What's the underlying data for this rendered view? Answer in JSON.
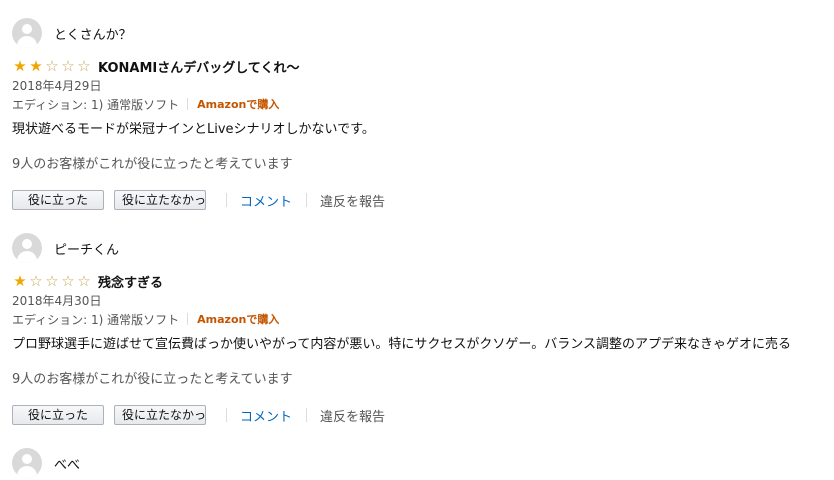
{
  "reviews": [
    {
      "author": "とくさんか？",
      "rating": 2,
      "rating_max": 5,
      "title": "KONAMIさんデバッグしてくれ～",
      "date": "2018年4月29日",
      "format": "エディション: 1) 通常版ソフト",
      "verified": "Amazonで購入",
      "body": "現状遊べるモードが栄冠ナインとLiveシナリオしかないです。",
      "helpful": "9人のお客様がこれが役に立ったと考えています",
      "helpful_button": "役に立った",
      "unhelpful_button": "役に立たなかった",
      "comment_link": "コメント",
      "report_link": "違反を報告"
    },
    {
      "author": "ピーチくん",
      "rating": 1,
      "rating_max": 5,
      "title": "残念すぎる",
      "date": "2018年4月30日",
      "format": "エディション: 1) 通常版ソフト",
      "verified": "Amazonで購入",
      "body": "プロ野球選手に遊ばせて宣伝費ばっか使いやがって内容が悪い。特にサクセスがクソゲー。バランス調整のアプデ来なきゃゲオに売る",
      "helpful": "9人のお客様がこれが役に立ったと考えています",
      "helpful_button": "役に立った",
      "unhelpful_button": "役に立たなかった",
      "comment_link": "コメント",
      "report_link": "違反を報告"
    },
    {
      "author": "べべ"
    }
  ],
  "colors": {
    "star_on": "#f0a500",
    "link": "#0066c0",
    "verified": "#c45500"
  }
}
